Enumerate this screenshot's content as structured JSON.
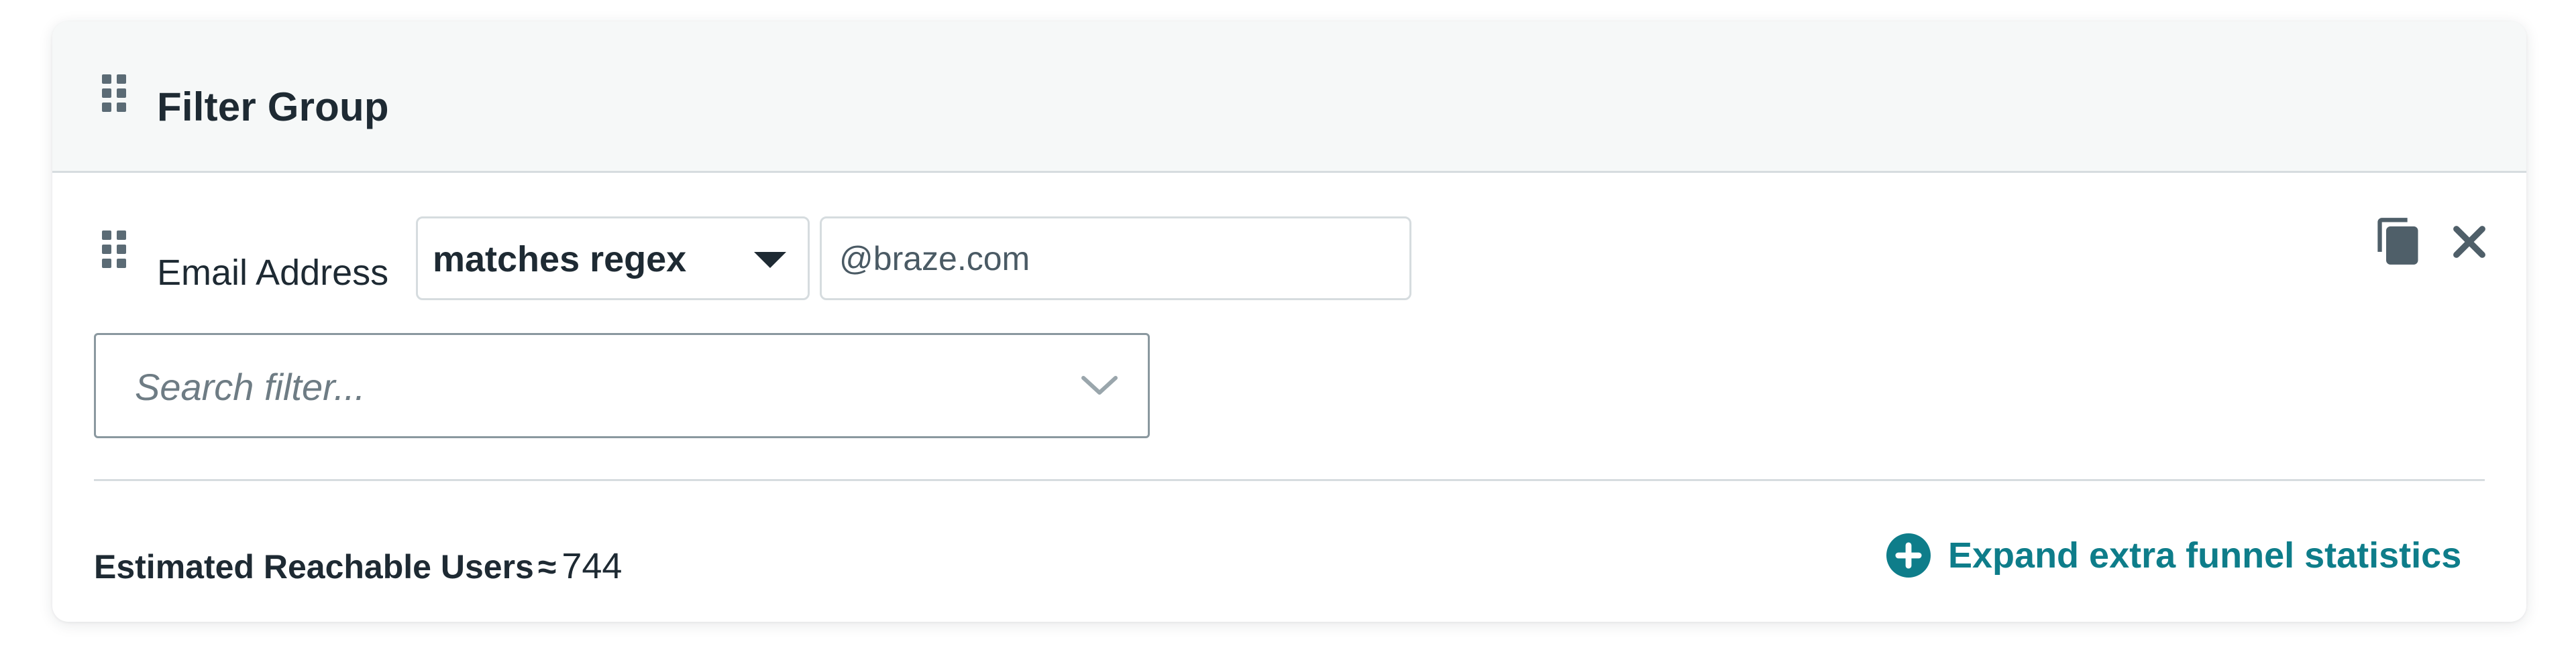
{
  "filter_group": {
    "title": "Filter Group"
  },
  "filter_row": {
    "field_label": "Email Address",
    "operator": {
      "selected": "matches regex"
    },
    "value_input": {
      "value": "@braze.com"
    }
  },
  "search_filter": {
    "placeholder": "Search filter..."
  },
  "footer": {
    "reach_label": "Estimated Reachable Users",
    "approx_symbol": "≈",
    "reach_value": "744",
    "expand_link_label": "Expand extra funnel statistics"
  },
  "colors": {
    "accent": "#0e7d8a",
    "text": "#1e2a33",
    "header_bg": "#f6f8f8",
    "border": "#d6dcdf"
  },
  "icons": {
    "drag_handle": "grip-vertical-icon",
    "dropdown": "caret-down-icon",
    "copy": "copy-icon",
    "close": "close-icon",
    "search_chevron": "chevron-down-icon",
    "expand": "plus-circle-icon"
  }
}
